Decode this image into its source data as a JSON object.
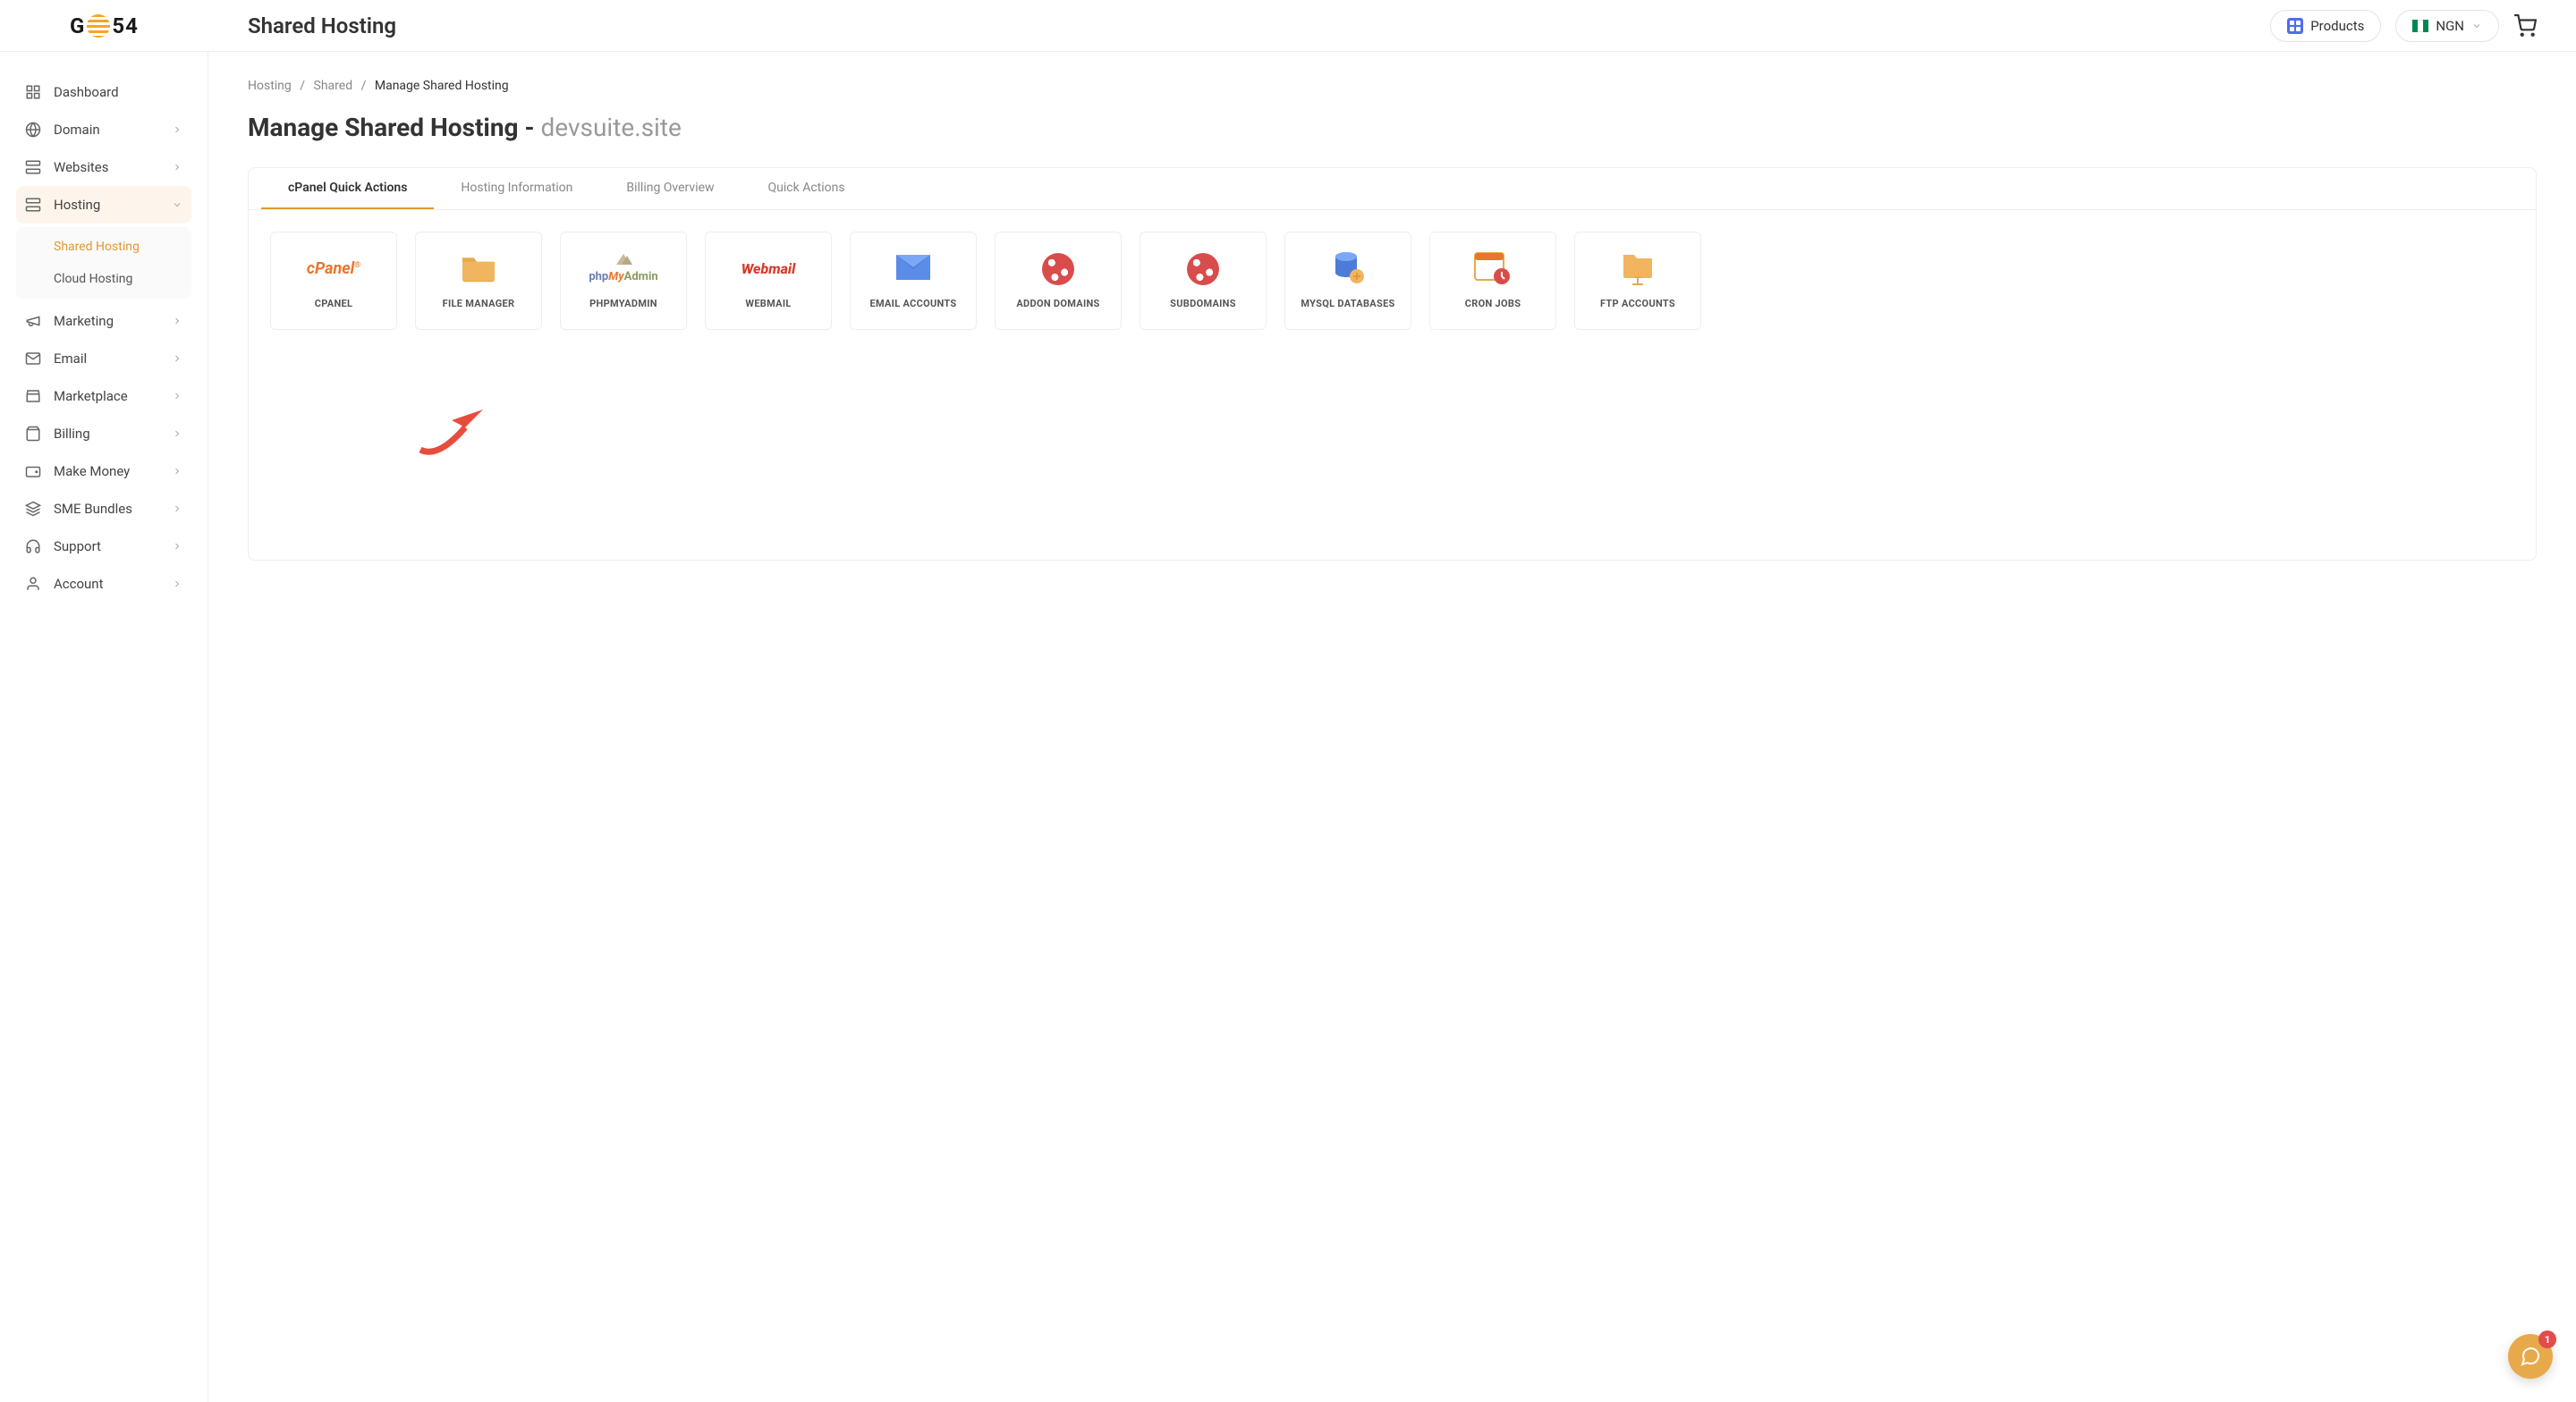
{
  "header": {
    "logo": "GO54",
    "title": "Shared Hosting",
    "products_label": "Products",
    "currency": "NGN"
  },
  "sidebar": {
    "items": [
      {
        "label": "Dashboard",
        "icon": "dashboard"
      },
      {
        "label": "Domain",
        "icon": "globe",
        "expandable": true
      },
      {
        "label": "Websites",
        "icon": "server",
        "expandable": true
      },
      {
        "label": "Hosting",
        "icon": "server",
        "expandable": true,
        "expanded": true,
        "children": [
          {
            "label": "Shared Hosting",
            "active": true
          },
          {
            "label": "Cloud Hosting"
          }
        ]
      },
      {
        "label": "Marketing",
        "icon": "megaphone",
        "expandable": true
      },
      {
        "label": "Email",
        "icon": "mail",
        "expandable": true
      },
      {
        "label": "Marketplace",
        "icon": "store",
        "expandable": true
      },
      {
        "label": "Billing",
        "icon": "bag",
        "expandable": true
      },
      {
        "label": "Make Money",
        "icon": "wallet",
        "expandable": true
      },
      {
        "label": "SME Bundles",
        "icon": "layers",
        "expandable": true
      },
      {
        "label": "Support",
        "icon": "headphones",
        "expandable": true
      },
      {
        "label": "Account",
        "icon": "user",
        "expandable": true
      }
    ]
  },
  "breadcrumb": {
    "items": [
      "Hosting",
      "Shared",
      "Manage Shared Hosting"
    ]
  },
  "page": {
    "title_prefix": "Manage Shared Hosting - ",
    "domain": "devsuite.site"
  },
  "tabs": [
    {
      "label": "cPanel Quick Actions",
      "active": true
    },
    {
      "label": "Hosting Information"
    },
    {
      "label": "Billing Overview"
    },
    {
      "label": "Quick Actions"
    }
  ],
  "cards": [
    {
      "label": "CPANEL",
      "icon": "cpanel"
    },
    {
      "label": "FILE MANAGER",
      "icon": "folder"
    },
    {
      "label": "PHPMYADMIN",
      "icon": "phpmyadmin"
    },
    {
      "label": "WEBMAIL",
      "icon": "webmail"
    },
    {
      "label": "EMAIL ACCOUNTS",
      "icon": "envelope"
    },
    {
      "label": "ADDON DOMAINS",
      "icon": "globe"
    },
    {
      "label": "SUBDOMAINS",
      "icon": "globe"
    },
    {
      "label": "MYSQL DATABASES",
      "icon": "database"
    },
    {
      "label": "CRON JOBS",
      "icon": "calendar"
    },
    {
      "label": "FTP ACCOUNTS",
      "icon": "ftp"
    }
  ],
  "chat": {
    "badge": "1"
  }
}
